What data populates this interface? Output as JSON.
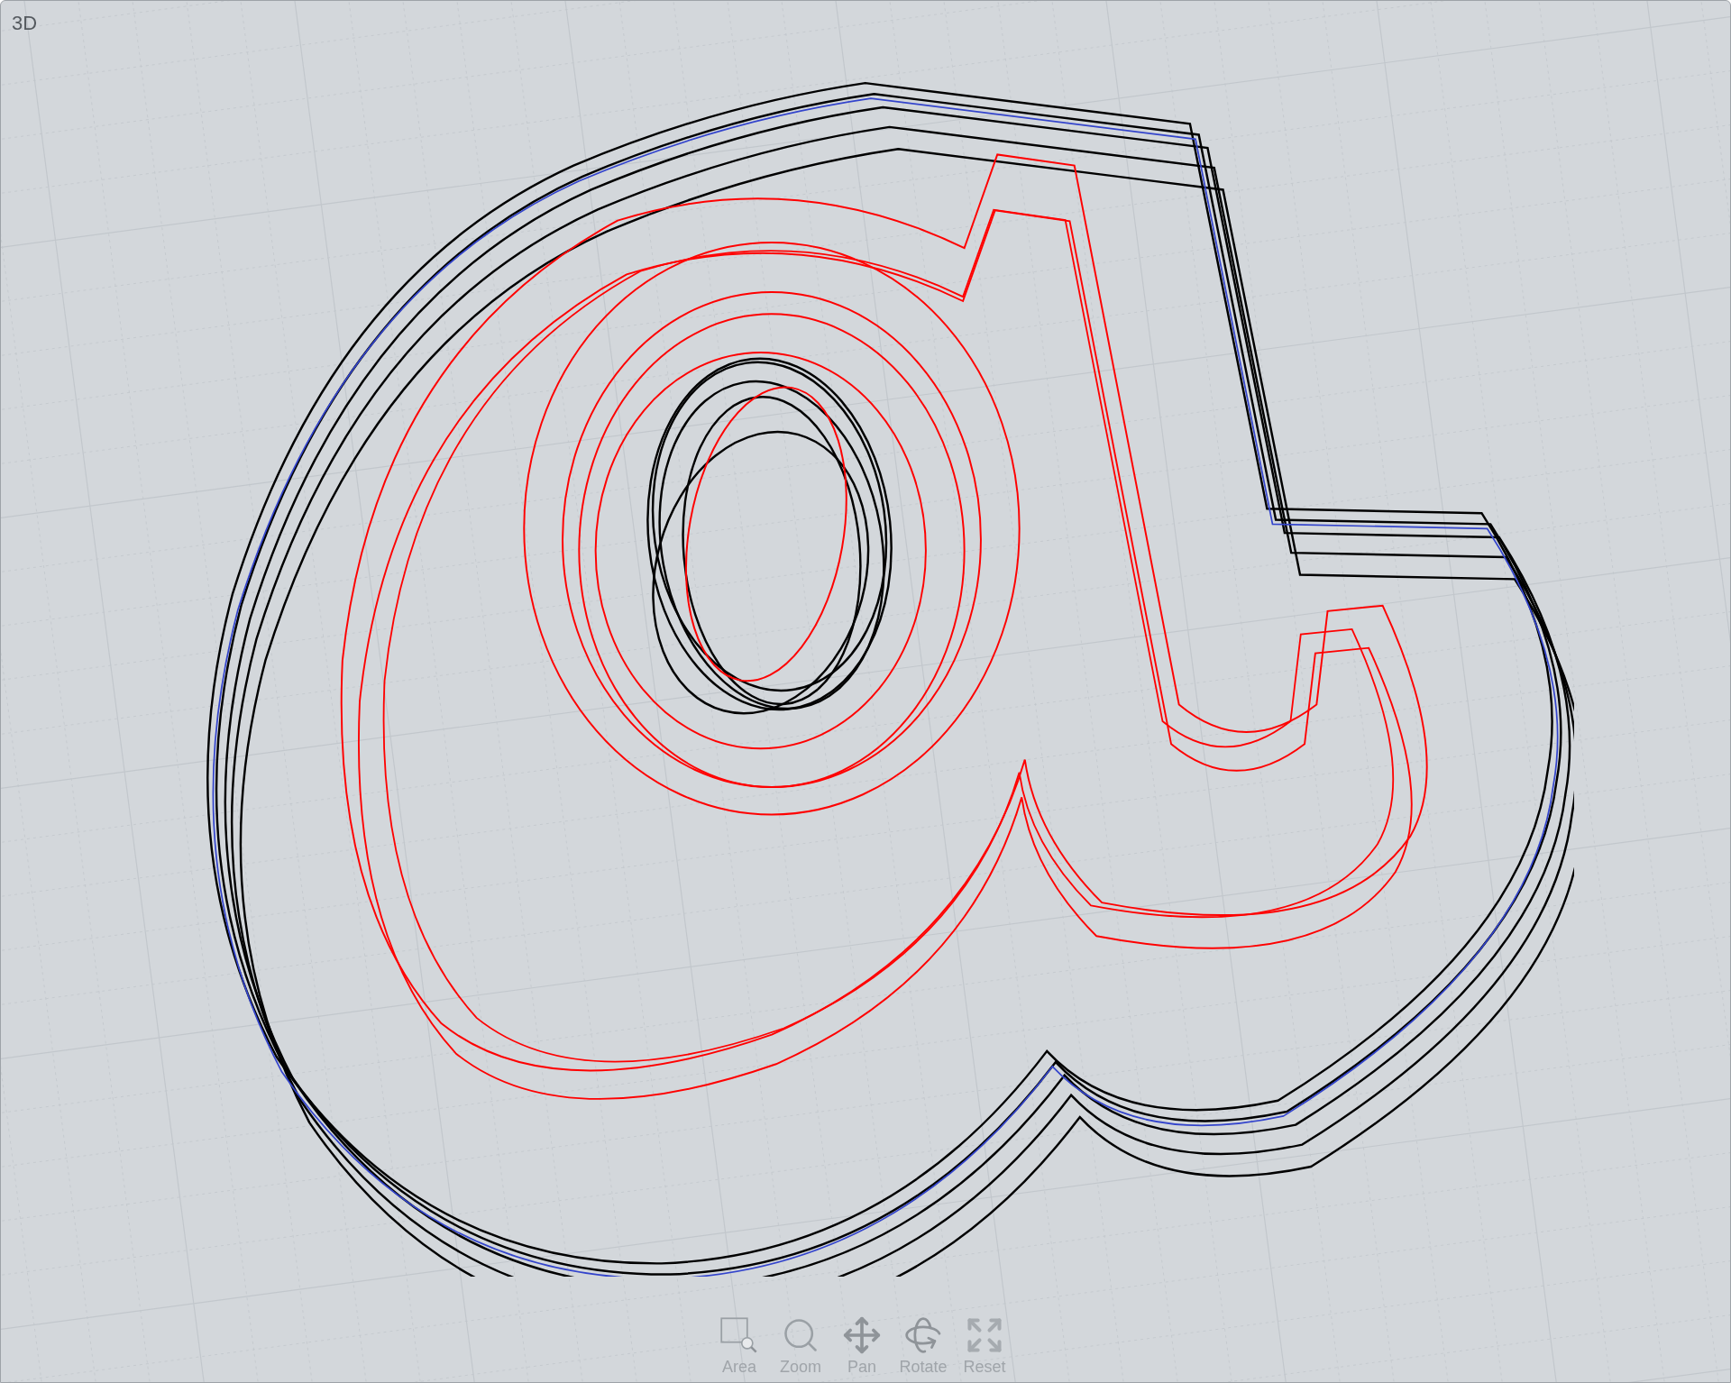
{
  "viewport": {
    "label": "3D"
  },
  "toolbar": [
    {
      "kind": "area",
      "label": "Area"
    },
    {
      "kind": "zoom",
      "label": "Zoom"
    },
    {
      "kind": "pan",
      "label": "Pan"
    },
    {
      "kind": "rotate",
      "label": "Rotate"
    },
    {
      "kind": "reset",
      "label": "Reset"
    }
  ]
}
